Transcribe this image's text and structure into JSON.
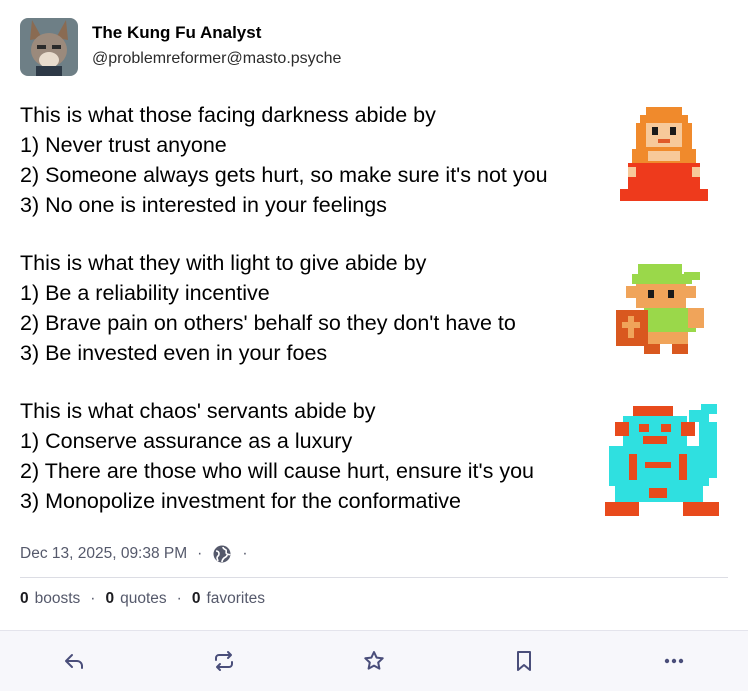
{
  "account": {
    "display_name": "The Kung Fu Analyst",
    "handle": "@problemreformer@masto.psyche",
    "avatar_icon": "fox-avatar"
  },
  "content": {
    "paragraphs": [
      {
        "heading": "This is what those facing darkness abide by",
        "items": [
          "1) Never trust anyone",
          "2) Someone always gets hurt, so make sure it's not you",
          "3) No one is interested in your feelings"
        ],
        "sprite_icon": "pixel-princess-sprite"
      },
      {
        "heading": "This is what they with light to give abide by",
        "items": [
          "1) Be a reliability incentive",
          "2) Brave pain on others' behalf so they don't have to",
          "3) Be invested even in your foes"
        ],
        "sprite_icon": "pixel-hero-sprite"
      },
      {
        "heading": "This is what chaos' servants abide by",
        "items": [
          "1) Conserve assurance as a luxury",
          "2) There are those who will cause hurt, ensure it's you",
          "3) Monopolize investment for the conformative"
        ],
        "sprite_icon": "pixel-villain-sprite"
      }
    ]
  },
  "meta": {
    "timestamp": "Dec 13, 2025, 09:38 PM",
    "separator": "·",
    "visibility_icon": "globe-icon"
  },
  "stats": {
    "boosts_count": "0",
    "boosts_label": "boosts",
    "quotes_count": "0",
    "quotes_label": "quotes",
    "favorites_count": "0",
    "favorites_label": "favorites",
    "separator": "·"
  },
  "actions": [
    "reply-icon",
    "boost-icon",
    "favorite-icon",
    "bookmark-icon",
    "more-icon"
  ],
  "colors": {
    "text": "#000000",
    "muted": "#55596b",
    "icon": "#4a4e7a",
    "actionbar_bg": "#f7f7fb"
  }
}
